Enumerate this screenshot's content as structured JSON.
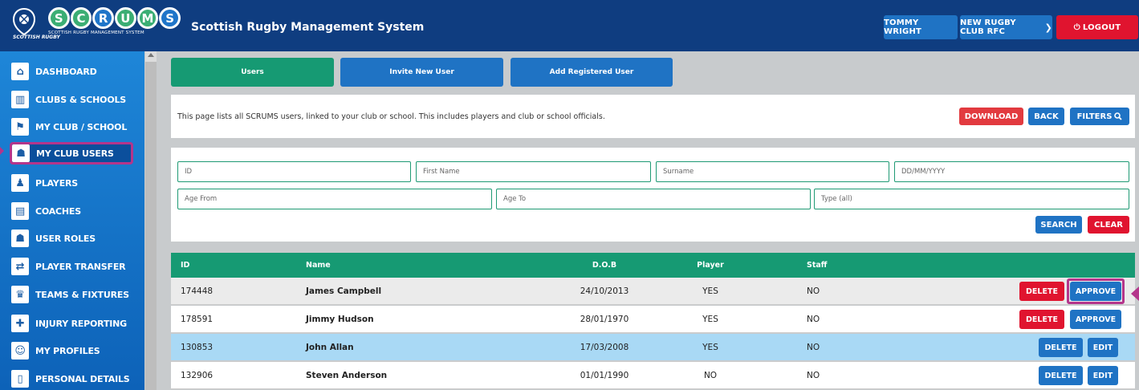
{
  "header": {
    "crest_text": "SCOTTISH RUGBY",
    "logo_letters": [
      "S",
      "C",
      "R",
      "U",
      "M",
      "S"
    ],
    "logo_sub": "SCOTTISH RUGBY MANAGEMENT SYSTEM",
    "app_title": "Scottish Rugby Management System",
    "user_name": "TOMMY WRIGHT",
    "club_name": "NEW RUGBY CLUB RFC",
    "logout_label": "LOGOUT"
  },
  "sidebar": {
    "items": [
      {
        "label": "DASHBOARD",
        "icon": "home-icon"
      },
      {
        "label": "CLUBS & SCHOOLS",
        "icon": "building-icon"
      },
      {
        "label": "MY CLUB / SCHOOL",
        "icon": "club-icon"
      },
      {
        "label": "MY CLUB USERS",
        "icon": "users-icon",
        "active": true
      },
      {
        "label": "PLAYERS",
        "icon": "player-icon"
      },
      {
        "label": "COACHES",
        "icon": "clipboard-icon"
      },
      {
        "label": "USER ROLES",
        "icon": "user-roles-icon"
      },
      {
        "label": "PLAYER TRANSFER",
        "icon": "transfer-icon"
      },
      {
        "label": "TEAMS & FIXTURES",
        "icon": "trophy-icon"
      },
      {
        "label": "INJURY REPORTING",
        "icon": "ambulance-icon"
      },
      {
        "label": "MY PROFILES",
        "icon": "profile-icon"
      },
      {
        "label": "PERSONAL DETAILS",
        "icon": "id-card-icon"
      }
    ]
  },
  "tabs": [
    {
      "label": "Users"
    },
    {
      "label": "Invite New User"
    },
    {
      "label": "Add Registered User"
    }
  ],
  "info": {
    "text": "This page lists all SCRUMS users, linked to your club or school. This includes players and club or school officials.",
    "download_label": "DOWNLOAD",
    "back_label": "BACK",
    "filters_label": "FILTERS"
  },
  "filters": {
    "id_placeholder": "ID",
    "first_name_placeholder": "First Name",
    "surname_placeholder": "Surname",
    "dob_placeholder": "DD/MM/YYYY",
    "age_from_placeholder": "Age From",
    "age_to_placeholder": "Age To",
    "type_placeholder": "Type (all)",
    "search_label": "SEARCH",
    "clear_label": "CLEAR"
  },
  "table": {
    "headers": {
      "id": "ID",
      "name": "Name",
      "dob": "D.O.B",
      "player": "Player",
      "staff": "Staff"
    },
    "rows": [
      {
        "id": "174448",
        "name": "James Campbell",
        "dob": "24/10/2013",
        "player": "YES",
        "staff": "NO",
        "action1": "DELETE",
        "action2": "APPROVE"
      },
      {
        "id": "178591",
        "name": "Jimmy Hudson",
        "dob": "28/01/1970",
        "player": "YES",
        "staff": "NO",
        "action1": "DELETE",
        "action2": "APPROVE"
      },
      {
        "id": "130853",
        "name": "John Allan",
        "dob": "17/03/2008",
        "player": "YES",
        "staff": "NO",
        "action1": "DELETE",
        "action2": "EDIT"
      },
      {
        "id": "132906",
        "name": "Steven Anderson",
        "dob": "01/01/1990",
        "player": "NO",
        "staff": "NO",
        "action1": "DELETE",
        "action2": "EDIT"
      }
    ]
  },
  "colors": {
    "header_bg": "#0f3d80",
    "sidebar_bg": "#1a7bd0",
    "accent_green": "#169a73",
    "accent_blue": "#1f73c4",
    "danger_red": "#e0142f",
    "highlight_magenta": "#b4358b",
    "selected_row": "#a9d9f5"
  }
}
